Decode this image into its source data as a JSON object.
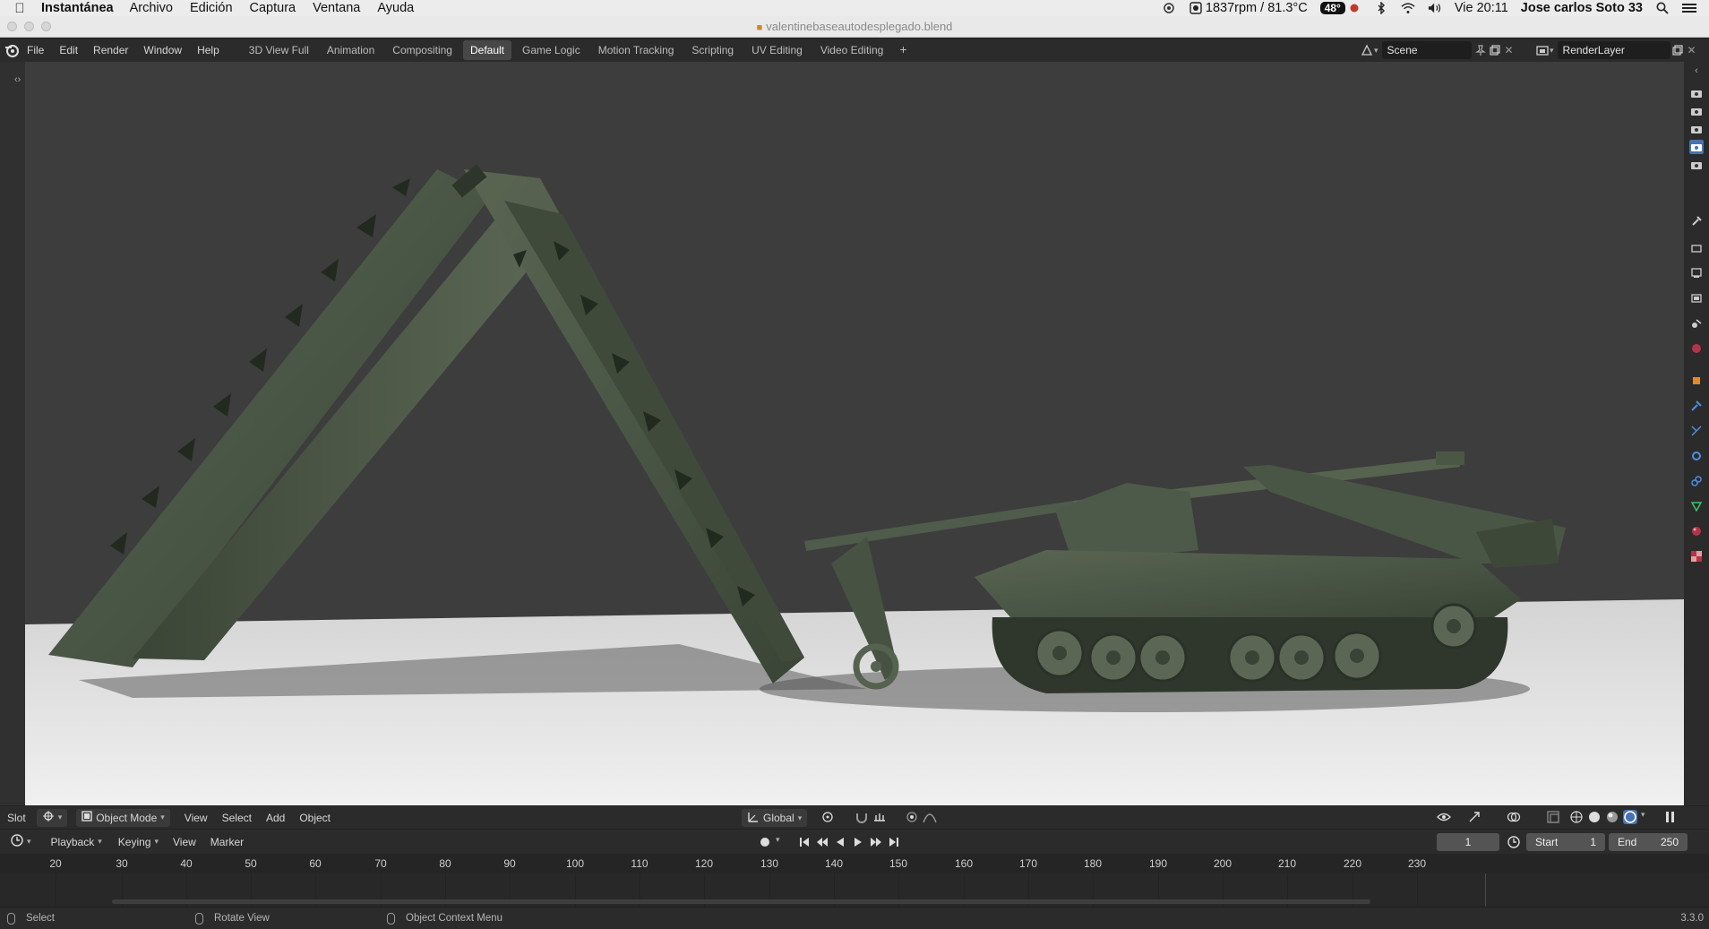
{
  "mac": {
    "app_name": "Instantánea",
    "menus": [
      "Archivo",
      "Edición",
      "Captura",
      "Ventana",
      "Ayuda"
    ],
    "fan_status": "1837rpm / 81.3°C",
    "temp_badge": "48°",
    "clock": "Vie 20:11",
    "user": "Jose carlos Soto 33"
  },
  "window": {
    "title": "valentinebaseautodesplegado.blend"
  },
  "blender": {
    "menus": [
      "File",
      "Edit",
      "Render",
      "Window",
      "Help"
    ],
    "workspaces": [
      "3D View Full",
      "Animation",
      "Compositing",
      "Default",
      "Game Logic",
      "Motion Tracking",
      "Scripting",
      "UV Editing",
      "Video Editing"
    ],
    "active_workspace": "Default",
    "add_workspace": "+",
    "scene": "Scene",
    "render_layer": "RenderLayer"
  },
  "viewport_header": {
    "slot_label": "Slot",
    "mode": "Object Mode",
    "menus": [
      "View",
      "Select",
      "Add",
      "Object"
    ],
    "orientation": "Global"
  },
  "timeline": {
    "menus": [
      "Playback",
      "Keying",
      "View",
      "Marker"
    ],
    "current_frame": "1",
    "start_label": "Start",
    "start_value": "1",
    "end_label": "End",
    "end_value": "250",
    "ticks": [
      "20",
      "30",
      "40",
      "50",
      "60",
      "70",
      "80",
      "90",
      "100",
      "110",
      "120",
      "130",
      "140",
      "150",
      "160",
      "170",
      "180",
      "190",
      "200",
      "210",
      "220",
      "230"
    ]
  },
  "status": {
    "select": "Select",
    "rotate": "Rotate View",
    "context": "Object Context Menu",
    "version": "3.3.0"
  },
  "colors": {
    "accent": "#4772b3",
    "viewport_bg": "#3d3d3d",
    "ground": "#e6e6e6",
    "olive": "#4d5a47"
  }
}
